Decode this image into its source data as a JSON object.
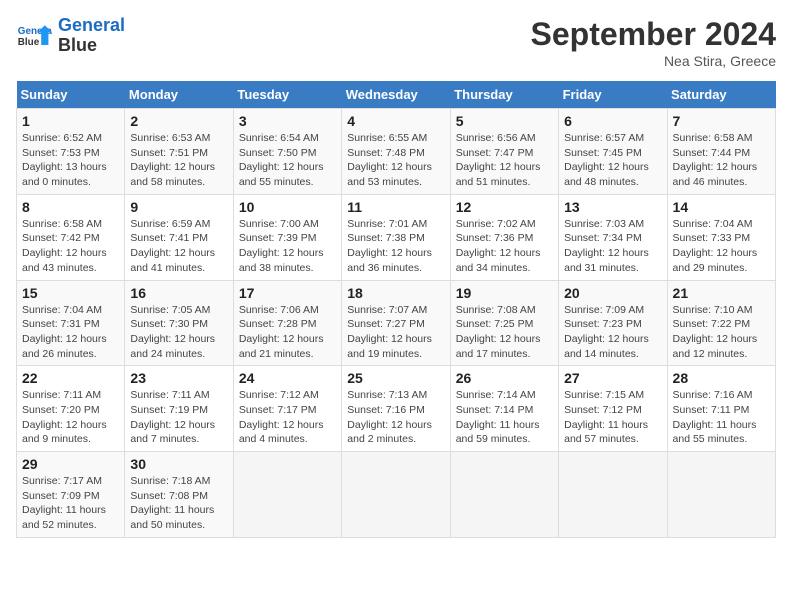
{
  "header": {
    "logo_line1": "General",
    "logo_line2": "Blue",
    "month": "September 2024",
    "location": "Nea Stira, Greece"
  },
  "weekdays": [
    "Sunday",
    "Monday",
    "Tuesday",
    "Wednesday",
    "Thursday",
    "Friday",
    "Saturday"
  ],
  "weeks": [
    [
      {
        "day": "1",
        "info": "Sunrise: 6:52 AM\nSunset: 7:53 PM\nDaylight: 13 hours\nand 0 minutes."
      },
      {
        "day": "2",
        "info": "Sunrise: 6:53 AM\nSunset: 7:51 PM\nDaylight: 12 hours\nand 58 minutes."
      },
      {
        "day": "3",
        "info": "Sunrise: 6:54 AM\nSunset: 7:50 PM\nDaylight: 12 hours\nand 55 minutes."
      },
      {
        "day": "4",
        "info": "Sunrise: 6:55 AM\nSunset: 7:48 PM\nDaylight: 12 hours\nand 53 minutes."
      },
      {
        "day": "5",
        "info": "Sunrise: 6:56 AM\nSunset: 7:47 PM\nDaylight: 12 hours\nand 51 minutes."
      },
      {
        "day": "6",
        "info": "Sunrise: 6:57 AM\nSunset: 7:45 PM\nDaylight: 12 hours\nand 48 minutes."
      },
      {
        "day": "7",
        "info": "Sunrise: 6:58 AM\nSunset: 7:44 PM\nDaylight: 12 hours\nand 46 minutes."
      }
    ],
    [
      {
        "day": "8",
        "info": "Sunrise: 6:58 AM\nSunset: 7:42 PM\nDaylight: 12 hours\nand 43 minutes."
      },
      {
        "day": "9",
        "info": "Sunrise: 6:59 AM\nSunset: 7:41 PM\nDaylight: 12 hours\nand 41 minutes."
      },
      {
        "day": "10",
        "info": "Sunrise: 7:00 AM\nSunset: 7:39 PM\nDaylight: 12 hours\nand 38 minutes."
      },
      {
        "day": "11",
        "info": "Sunrise: 7:01 AM\nSunset: 7:38 PM\nDaylight: 12 hours\nand 36 minutes."
      },
      {
        "day": "12",
        "info": "Sunrise: 7:02 AM\nSunset: 7:36 PM\nDaylight: 12 hours\nand 34 minutes."
      },
      {
        "day": "13",
        "info": "Sunrise: 7:03 AM\nSunset: 7:34 PM\nDaylight: 12 hours\nand 31 minutes."
      },
      {
        "day": "14",
        "info": "Sunrise: 7:04 AM\nSunset: 7:33 PM\nDaylight: 12 hours\nand 29 minutes."
      }
    ],
    [
      {
        "day": "15",
        "info": "Sunrise: 7:04 AM\nSunset: 7:31 PM\nDaylight: 12 hours\nand 26 minutes."
      },
      {
        "day": "16",
        "info": "Sunrise: 7:05 AM\nSunset: 7:30 PM\nDaylight: 12 hours\nand 24 minutes."
      },
      {
        "day": "17",
        "info": "Sunrise: 7:06 AM\nSunset: 7:28 PM\nDaylight: 12 hours\nand 21 minutes."
      },
      {
        "day": "18",
        "info": "Sunrise: 7:07 AM\nSunset: 7:27 PM\nDaylight: 12 hours\nand 19 minutes."
      },
      {
        "day": "19",
        "info": "Sunrise: 7:08 AM\nSunset: 7:25 PM\nDaylight: 12 hours\nand 17 minutes."
      },
      {
        "day": "20",
        "info": "Sunrise: 7:09 AM\nSunset: 7:23 PM\nDaylight: 12 hours\nand 14 minutes."
      },
      {
        "day": "21",
        "info": "Sunrise: 7:10 AM\nSunset: 7:22 PM\nDaylight: 12 hours\nand 12 minutes."
      }
    ],
    [
      {
        "day": "22",
        "info": "Sunrise: 7:11 AM\nSunset: 7:20 PM\nDaylight: 12 hours\nand 9 minutes."
      },
      {
        "day": "23",
        "info": "Sunrise: 7:11 AM\nSunset: 7:19 PM\nDaylight: 12 hours\nand 7 minutes."
      },
      {
        "day": "24",
        "info": "Sunrise: 7:12 AM\nSunset: 7:17 PM\nDaylight: 12 hours\nand 4 minutes."
      },
      {
        "day": "25",
        "info": "Sunrise: 7:13 AM\nSunset: 7:16 PM\nDaylight: 12 hours\nand 2 minutes."
      },
      {
        "day": "26",
        "info": "Sunrise: 7:14 AM\nSunset: 7:14 PM\nDaylight: 11 hours\nand 59 minutes."
      },
      {
        "day": "27",
        "info": "Sunrise: 7:15 AM\nSunset: 7:12 PM\nDaylight: 11 hours\nand 57 minutes."
      },
      {
        "day": "28",
        "info": "Sunrise: 7:16 AM\nSunset: 7:11 PM\nDaylight: 11 hours\nand 55 minutes."
      }
    ],
    [
      {
        "day": "29",
        "info": "Sunrise: 7:17 AM\nSunset: 7:09 PM\nDaylight: 11 hours\nand 52 minutes."
      },
      {
        "day": "30",
        "info": "Sunrise: 7:18 AM\nSunset: 7:08 PM\nDaylight: 11 hours\nand 50 minutes."
      },
      null,
      null,
      null,
      null,
      null
    ]
  ]
}
